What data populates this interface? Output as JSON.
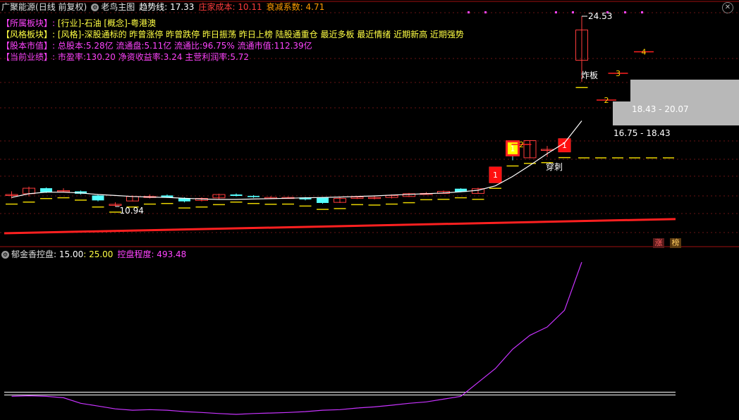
{
  "header": {
    "stock_name": "广聚能源",
    "mode": "(日线 前复权)",
    "indicator_name": "老鸟主图",
    "trend_label": "趋势线: 17.33",
    "cost_label": "庄家成本: 10.11",
    "decay_label": "衰减系数: 4.71"
  },
  "info_lines": [
    {
      "key": "【所属板块】:",
      "value": "[行业]-石油 [概念]-粤港澳"
    },
    {
      "key": "【风格板块】:",
      "value": "[风格]-深股通标的 昨曾涨停 昨曾跌停 昨日振荡 昨日上榜 陆股通重仓 最近多板 最近情绪 近期新高 近期强势"
    },
    {
      "key": "【股本市值】:",
      "value": "总股本:5.28亿 流通盘:5.11亿 流通比:96.75% 流通市值:112.39亿"
    },
    {
      "key": "【当前业绩】:",
      "value": "市盈率:130.20 净资收益率:3.24 主营利润率:5.72"
    }
  ],
  "sub_panel": {
    "name": "郁金香控盘",
    "v1": ": 15.00",
    "v2": ": 25.00",
    "degree_label": "控盘程度: 493.48"
  },
  "tags": {
    "zhang": "涨",
    "bang": "榜"
  },
  "chart_data": [
    {
      "type": "candlestick",
      "title": "老鸟主图",
      "annotations": {
        "low_price": "10.94",
        "high_price": "24.53",
        "zone_upper": "18.43 - 20.07",
        "zone_lower": "16.75 - 18.43",
        "explode_label": "炸板",
        "pierce_label": "穿刺",
        "box_labels": [
          "1",
          "1",
          "1"
        ],
        "step_labels": [
          "2",
          "2",
          "3",
          "4"
        ]
      },
      "colors": {
        "up": "#ff3b3b",
        "down": "#54ffff",
        "trend": "#ffffff",
        "cost": "#ff2020",
        "zone": "#b8b8b8"
      },
      "candles": [
        {
          "o": 11.55,
          "c": 11.55,
          "h": 11.75,
          "l": 11.35
        },
        {
          "o": 11.6,
          "c": 11.95,
          "h": 12.05,
          "l": 11.45
        },
        {
          "o": 11.95,
          "c": 11.7,
          "h": 12.0,
          "l": 11.65
        },
        {
          "o": 11.8,
          "c": 11.8,
          "h": 11.95,
          "l": 11.7
        },
        {
          "o": 11.75,
          "c": 11.6,
          "h": 11.8,
          "l": 11.55
        },
        {
          "o": 11.5,
          "c": 11.25,
          "h": 11.55,
          "l": 11.2
        },
        {
          "o": 11.05,
          "c": 11.05,
          "h": 11.15,
          "l": 10.94
        },
        {
          "o": 11.22,
          "c": 11.45,
          "h": 11.5,
          "l": 11.2
        },
        {
          "o": 11.45,
          "c": 11.45,
          "h": 11.55,
          "l": 11.35
        },
        {
          "o": 11.5,
          "c": 11.4,
          "h": 11.55,
          "l": 11.38
        },
        {
          "o": 11.35,
          "c": 11.2,
          "h": 11.4,
          "l": 11.15
        },
        {
          "o": 11.25,
          "c": 11.35,
          "h": 11.4,
          "l": 11.2
        },
        {
          "o": 11.38,
          "c": 11.55,
          "h": 11.6,
          "l": 11.32
        },
        {
          "o": 11.55,
          "c": 11.48,
          "h": 11.62,
          "l": 11.45
        },
        {
          "o": 11.48,
          "c": 11.42,
          "h": 11.52,
          "l": 11.38
        },
        {
          "o": 11.4,
          "c": 11.4,
          "h": 11.46,
          "l": 11.34
        },
        {
          "o": 11.38,
          "c": 11.4,
          "h": 11.44,
          "l": 11.35
        },
        {
          "o": 11.4,
          "c": 11.3,
          "h": 11.42,
          "l": 11.25
        },
        {
          "o": 11.4,
          "c": 11.12,
          "h": 11.42,
          "l": 11.08
        },
        {
          "o": 11.15,
          "c": 11.35,
          "h": 11.4,
          "l": 11.12
        },
        {
          "o": 11.35,
          "c": 11.42,
          "h": 11.45,
          "l": 11.32
        },
        {
          "o": 11.4,
          "c": 11.4,
          "h": 11.5,
          "l": 11.3
        },
        {
          "o": 11.4,
          "c": 11.5,
          "h": 11.55,
          "l": 11.35
        },
        {
          "o": 11.45,
          "c": 11.6,
          "h": 11.65,
          "l": 11.42
        },
        {
          "o": 11.62,
          "c": 11.62,
          "h": 11.7,
          "l": 11.58
        },
        {
          "o": 11.62,
          "c": 11.75,
          "h": 11.8,
          "l": 11.6
        },
        {
          "o": 11.92,
          "c": 11.72,
          "h": 11.95,
          "l": 11.7
        },
        {
          "o": 11.62,
          "c": 11.92,
          "h": 11.98,
          "l": 11.6
        },
        {
          "o": 12.3,
          "c": 13.3,
          "h": 13.3,
          "l": 12.3
        },
        {
          "o": 15.4,
          "c": 14.0,
          "h": 15.4,
          "l": 13.7
        },
        {
          "o": 13.85,
          "c": 15.5,
          "h": 15.55,
          "l": 13.85
        },
        {
          "o": 14.35,
          "c": 14.35,
          "h": 14.8,
          "l": 13.9
        },
        {
          "o": 14.2,
          "c": 15.75,
          "h": 15.75,
          "l": 14.2
        },
        {
          "o": 21.4,
          "c": 23.55,
          "h": 24.53,
          "l": 19.85
        }
      ],
      "trend_line": [
        11.4,
        11.6,
        11.7,
        11.7,
        11.65,
        11.55,
        11.5,
        11.45,
        11.42,
        11.4,
        11.36,
        11.32,
        11.3,
        11.3,
        11.32,
        11.34,
        11.36,
        11.38,
        11.4,
        11.42,
        11.45,
        11.48,
        11.52,
        11.56,
        11.6,
        11.65,
        11.72,
        11.82,
        12.1,
        12.7,
        13.4,
        14.1,
        15.2,
        17.33
      ],
      "cost_line_range": [
        10.11,
        10.55
      ]
    },
    {
      "type": "line",
      "title": "郁金香控盘",
      "reference_lines": [
        15.0,
        25.0
      ],
      "series": [
        {
          "name": "控盘程度",
          "values": [
            10,
            12,
            10,
            5,
            -15,
            -25,
            -35,
            -40,
            -38,
            -40,
            -45,
            -48,
            -52,
            -55,
            -52,
            -50,
            -48,
            -45,
            -40,
            -38,
            -32,
            -28,
            -22,
            -15,
            -10,
            0,
            10,
            60,
            110,
            180,
            230,
            260,
            320,
            493.48
          ]
        }
      ]
    }
  ]
}
